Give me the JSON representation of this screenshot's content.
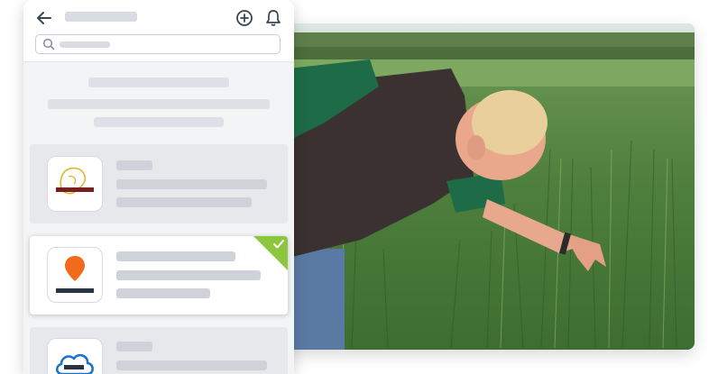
{
  "header": {
    "back_icon": "arrow-left-icon",
    "add_icon": "plus-circle-icon",
    "notifications_icon": "bell-icon"
  },
  "search": {
    "icon": "search-icon"
  },
  "cards": [
    {
      "logo_icon": "field-outline-logo-icon",
      "selected": false
    },
    {
      "logo_icon": "location-pin-logo-icon",
      "selected": true,
      "badge_icon": "checkmark-icon",
      "badge_color": "#8cc63f"
    },
    {
      "logo_icon": "cloud-logo-icon",
      "selected": false
    }
  ],
  "photo": {
    "subject": "field-inspection-photo"
  },
  "colors": {
    "placeholder": "#d9dde3",
    "selected_accent": "#8cc63f",
    "pin_orange": "#f26b1d"
  }
}
